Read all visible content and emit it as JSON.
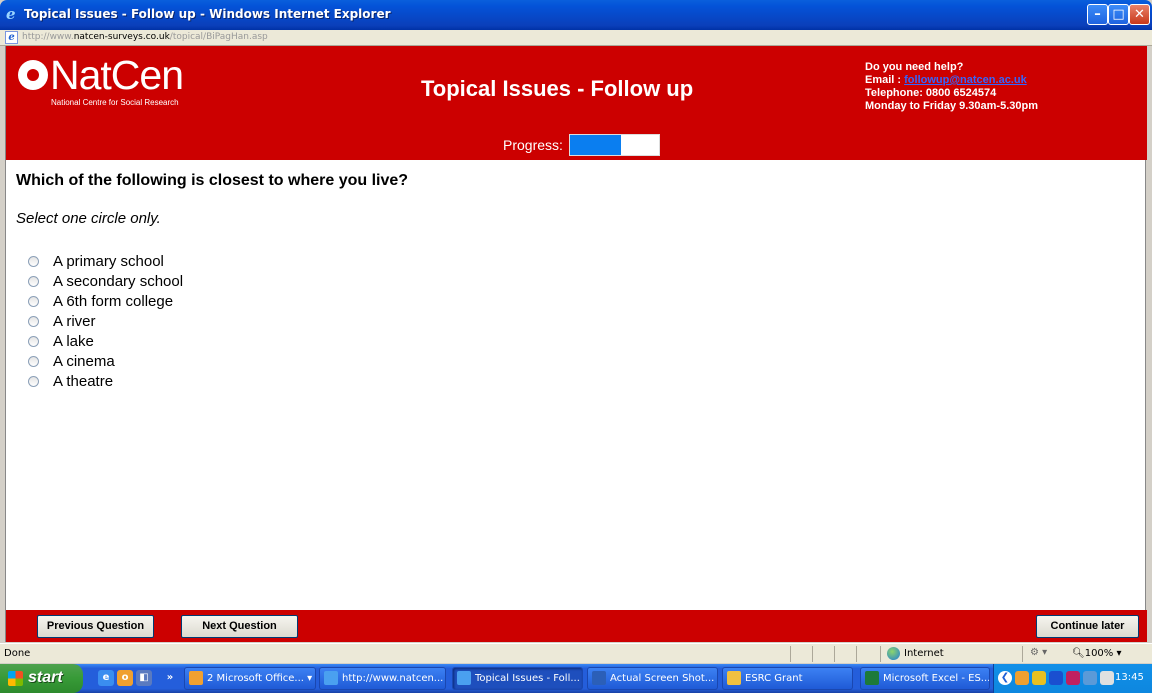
{
  "window": {
    "title": "Topical Issues - Follow up - Windows Internet Explorer",
    "min_glyph": "–",
    "max_glyph": "□",
    "close_glyph": "✕"
  },
  "address": {
    "url_prefix": "http://www.",
    "url_domain": "natcen-surveys.co.uk",
    "url_path": "/topical/BiPagHan.asp"
  },
  "header": {
    "logo_name": "NatCen",
    "logo_sub": "National Centre for Social Research",
    "title": "Topical Issues - Follow up",
    "help": {
      "line1": "Do you need help?",
      "email_label": "Email : ",
      "email": "followup@natcen.ac.uk",
      "phone": "Telephone: 0800 6524574",
      "hours": "Monday to Friday 9.30am-5.30pm"
    },
    "progress_label": "Progress:",
    "progress_fraction": 0.57,
    "progress_color": "#0a7ef0"
  },
  "question": {
    "text": "Which of the following is closest to where you live?",
    "instruction": "Select one circle only.",
    "options": [
      "A primary school",
      "A secondary school",
      "A 6th form college",
      "A river",
      "A lake",
      "A cinema",
      "A theatre"
    ]
  },
  "footer": {
    "previous": "Previous Question",
    "next": "Next Question",
    "continue_later": "Continue later"
  },
  "statusbar": {
    "status": "Done",
    "zone": "Internet",
    "zoom": "100%"
  },
  "taskbar": {
    "start": "start",
    "tasks": [
      {
        "label": "2 Microsoft Office...",
        "icon_color": "#f0a030"
      },
      {
        "label": "http://www.natcen...",
        "icon_color": "#4aa0f0"
      },
      {
        "label": "Topical Issues - Foll...",
        "icon_color": "#4aa0f0"
      },
      {
        "label": "Actual Screen Shot...",
        "icon_color": "#2b5fb8"
      },
      {
        "label": "ESRC Grant",
        "icon_color": "#f0c040"
      },
      {
        "label": "Microsoft Excel - ES...",
        "icon_color": "#1d7a3a"
      }
    ],
    "clock": "13:45"
  },
  "colors": {
    "brand_red": "#cc0000",
    "link_blue": "#3366ff"
  }
}
